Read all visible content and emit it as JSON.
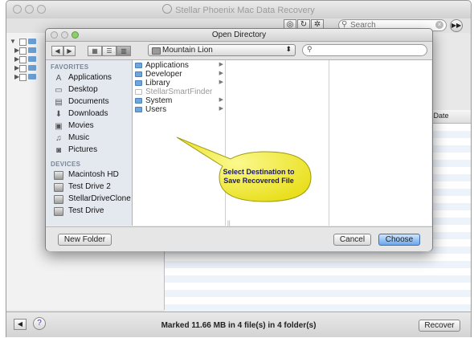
{
  "app": {
    "title": "Stellar Phoenix Mac Data Recovery",
    "toolbar": {
      "eye_glyph": "◎",
      "refresh_glyph": "↻",
      "gear_glyph": "✲",
      "search_placeholder": "Search",
      "forward_glyph": "▶▶"
    },
    "table": {
      "column_date_label": "n Date"
    },
    "status": {
      "text": "Marked 11.66 MB in 4 file(s) in 4 folder(s)",
      "back_glyph": "◀",
      "help_glyph": "?",
      "recover_label": "Recover"
    }
  },
  "dialog": {
    "title": "Open Directory",
    "nav_back": "◀",
    "nav_forward": "▶",
    "view_icon": "▦",
    "view_list": "☰",
    "view_column": "▥",
    "location": "Mountain Lion",
    "location_arrows": "⬍",
    "sidebar": {
      "favorites_heading": "FAVORITES",
      "favorites": [
        {
          "label": "Applications",
          "icon": "applications-icon",
          "glyph": "A"
        },
        {
          "label": "Desktop",
          "icon": "desktop-icon",
          "glyph": "▭"
        },
        {
          "label": "Documents",
          "icon": "documents-icon",
          "glyph": "▤"
        },
        {
          "label": "Downloads",
          "icon": "downloads-icon",
          "glyph": "⬇"
        },
        {
          "label": "Movies",
          "icon": "movies-icon",
          "glyph": "▣"
        },
        {
          "label": "Music",
          "icon": "music-icon",
          "glyph": "♫"
        },
        {
          "label": "Pictures",
          "icon": "pictures-icon",
          "glyph": "◙"
        }
      ],
      "devices_heading": "DEVICES",
      "devices": [
        {
          "label": "Macintosh HD",
          "icon": "hard-drive-icon"
        },
        {
          "label": "Test Drive 2",
          "icon": "hard-drive-icon"
        },
        {
          "label": "StellarDriveClone",
          "icon": "hard-drive-icon"
        },
        {
          "label": "Test Drive",
          "icon": "hard-drive-icon"
        }
      ]
    },
    "column_items": [
      {
        "label": "Applications",
        "has_children": true,
        "dimmed": false
      },
      {
        "label": "Developer",
        "has_children": true,
        "dimmed": false
      },
      {
        "label": "Library",
        "has_children": true,
        "dimmed": false
      },
      {
        "label": "StellarSmartFinder",
        "has_children": false,
        "dimmed": true
      },
      {
        "label": "System",
        "has_children": true,
        "dimmed": false
      },
      {
        "label": "Users",
        "has_children": true,
        "dimmed": false
      }
    ],
    "new_folder_label": "New Folder",
    "cancel_label": "Cancel",
    "choose_label": "Choose"
  },
  "callout": {
    "line1": "Select Destination to",
    "line2": "Save Recovered File"
  },
  "colors": {
    "choose_button": "#6aa7ec",
    "callout_fill": "#f5f04a",
    "callout_text": "#1a1a66",
    "folder": "#6fa6dc"
  }
}
